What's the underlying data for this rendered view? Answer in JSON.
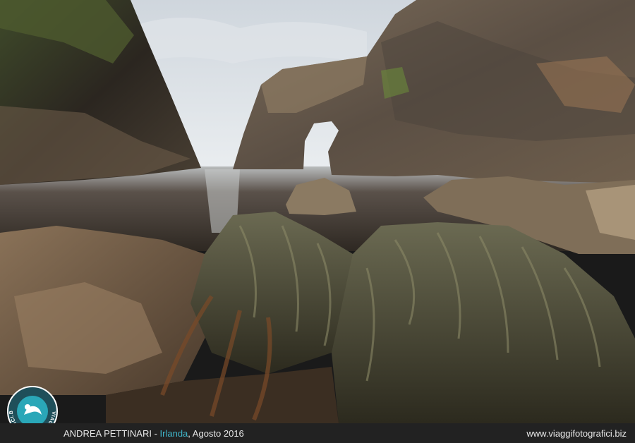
{
  "photo": {
    "description_icon": "sea-arch-landscape"
  },
  "logo": {
    "text": "VIAGGIFOTOGRAFICI.BIZ",
    "ring_color": "#ffffff",
    "accent_color": "#2aa7b8"
  },
  "footer": {
    "author": "ANDREA PETTINARI",
    "separator": " - ",
    "place": "Irlanda",
    "date": ", Agosto 2016",
    "website": "www.viaggifotografici.biz",
    "accent_color": "#3fb5c9"
  }
}
